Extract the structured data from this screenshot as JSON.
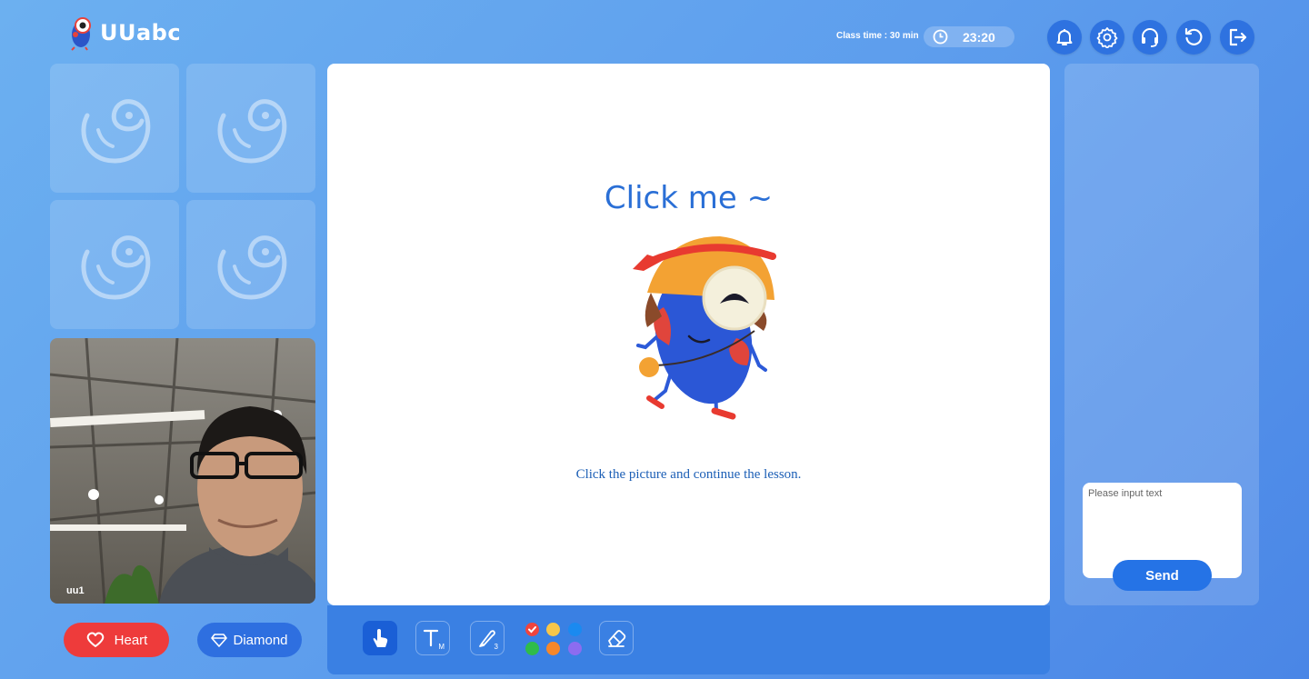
{
  "header": {
    "brand": "UUabc",
    "class_time": "Class time : 30 min",
    "timer": "23:20",
    "buttons": [
      "bell-icon",
      "gear-icon",
      "headset-icon",
      "refresh-icon",
      "exit-icon"
    ]
  },
  "video": {
    "name": "uu1"
  },
  "reactions": {
    "heart": "Heart",
    "diamond": "Diamond"
  },
  "board": {
    "title": "Click me ~",
    "instruction": "Click the picture and continue the lesson."
  },
  "toolbar": {
    "tools": [
      "pointer-icon",
      "text-icon",
      "pen-icon",
      "eraser-icon"
    ],
    "text_size": "M",
    "pen_size": "3",
    "colors": [
      "#f0443d",
      "#f7c64a",
      "#1a8af0",
      "#2fbc4a",
      "#f6872a",
      "#8c6cf0"
    ]
  },
  "chat": {
    "placeholder": "Please input text",
    "send": "Send"
  },
  "colors": {
    "accent": "#2573e6",
    "heart": "#ee3b3b",
    "diamond": "#2e6fe0"
  }
}
